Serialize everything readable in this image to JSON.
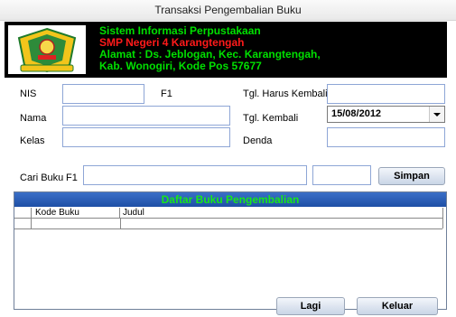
{
  "window": {
    "title": "Transaksi Pengembalian Buku"
  },
  "header": {
    "line1": "Sistem Informasi Perpustakaan",
    "line2": "SMP Negeri 4 Karangtengah",
    "line3": "Alamat : Ds. Jeblogan, Kec. Karangtengah,",
    "line4": "Kab. Wonogiri, Kode Pos 57677",
    "logo_text": "SPEN KA RA",
    "colors": {
      "green": "#00e000",
      "red": "#ff1a1a",
      "background": "#000000"
    }
  },
  "form": {
    "nis_label": "NIS",
    "nis_hint": "F1",
    "nis_value": "",
    "nama_label": "Nama",
    "nama_value": "",
    "kelas_label": "Kelas",
    "kelas_value": "",
    "tgl_harus_label": "Tgl. Harus Kembali",
    "tgl_harus_value": "",
    "tgl_kembali_label": "Tgl. Kembali",
    "tgl_kembali_value": "15/08/2012",
    "denda_label": "Denda",
    "denda_value": "",
    "cari_label": "Cari Buku",
    "cari_hint": "F1",
    "cari_value": "",
    "qty_value": ""
  },
  "buttons": {
    "simpan": "Simpan",
    "lagi": "Lagi",
    "keluar": "Keluar"
  },
  "table": {
    "title": "Daftar Buku Pengembalian",
    "columns": [
      "Kode Buku",
      "Judul"
    ],
    "rows": []
  }
}
